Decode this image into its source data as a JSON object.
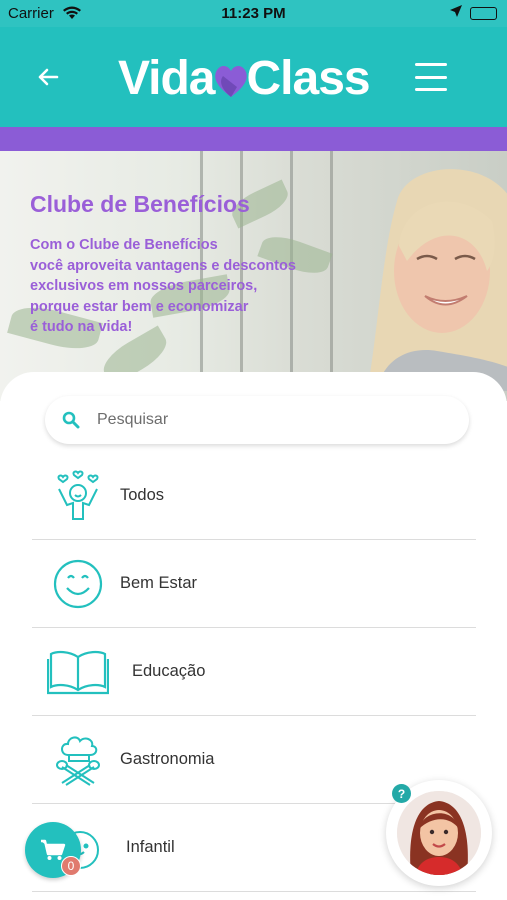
{
  "status_bar": {
    "carrier": "Carrier",
    "time": "11:23 PM"
  },
  "header": {
    "logo_left": "Vida",
    "logo_right": "Class"
  },
  "hero": {
    "title": "Clube de Benefícios",
    "text_lines": [
      "Com o Clube de Benefícios",
      "você aproveita vantagens e descontos",
      "exclusivos em nossos parceiros,",
      "porque estar bem e economizar",
      "é tudo na vida!"
    ]
  },
  "search": {
    "placeholder": "Pesquisar"
  },
  "categories": [
    {
      "label": "Todos",
      "icon": "celebrating-person-icon"
    },
    {
      "label": "Bem Estar",
      "icon": "smiley-face-icon"
    },
    {
      "label": "Educação",
      "icon": "open-book-icon"
    },
    {
      "label": "Gastronomia",
      "icon": "chef-hat-icon"
    },
    {
      "label": "Infantil",
      "icon": "baby-face-icon"
    }
  ],
  "cart": {
    "count": "0"
  },
  "assistant": {
    "help": "?"
  },
  "colors": {
    "teal": "#23c0be",
    "purple": "#8b5cd6",
    "hero_text": "#9a5fd8"
  }
}
